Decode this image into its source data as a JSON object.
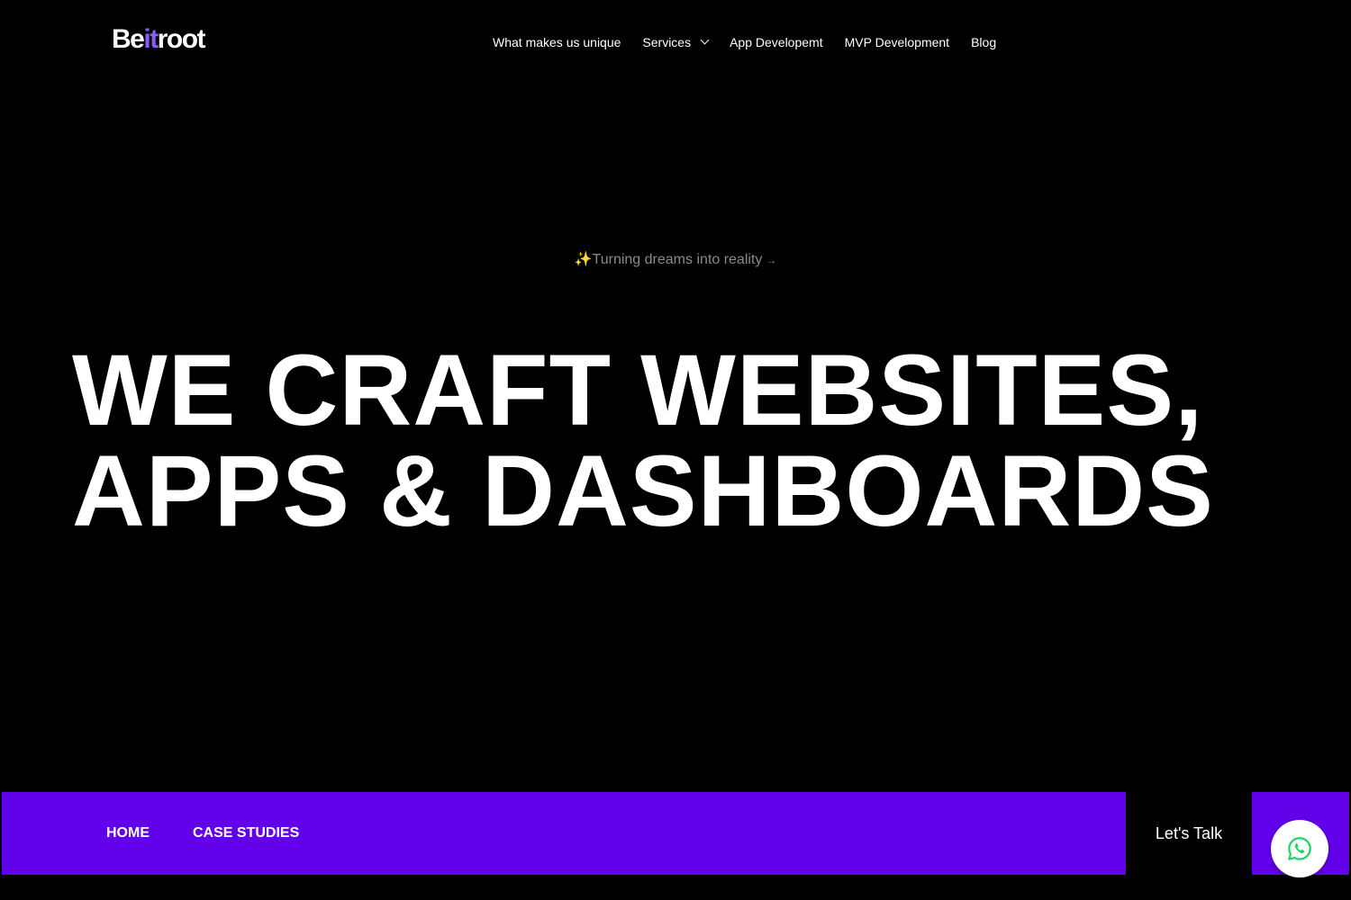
{
  "header": {
    "logo": {
      "part1": "Be",
      "part2": "it",
      "part3": "root"
    },
    "nav": [
      {
        "label": "What makes us unique"
      },
      {
        "label": "Services",
        "has_dropdown": true
      },
      {
        "label": "App Developemt"
      },
      {
        "label": "MVP Development"
      },
      {
        "label": "Blog"
      }
    ]
  },
  "hero": {
    "tagline": "Turning dreams into reality",
    "tagline_sparkle": "✨",
    "tagline_arrow": "→",
    "headline_line1": "WE CRAFT WEBSITES,",
    "headline_line2": "APPS & DASHBOARDS"
  },
  "bottom_bar": {
    "links": [
      {
        "label": "HOME"
      },
      {
        "label": "CASE STUDIES"
      }
    ],
    "cta": "Let's Talk"
  },
  "floating": {
    "icon": "whatsapp-icon"
  },
  "colors": {
    "accent": "#6200ea",
    "logo_accent": "#8b5cf6",
    "whatsapp": "#25d366",
    "background": "#000000"
  }
}
